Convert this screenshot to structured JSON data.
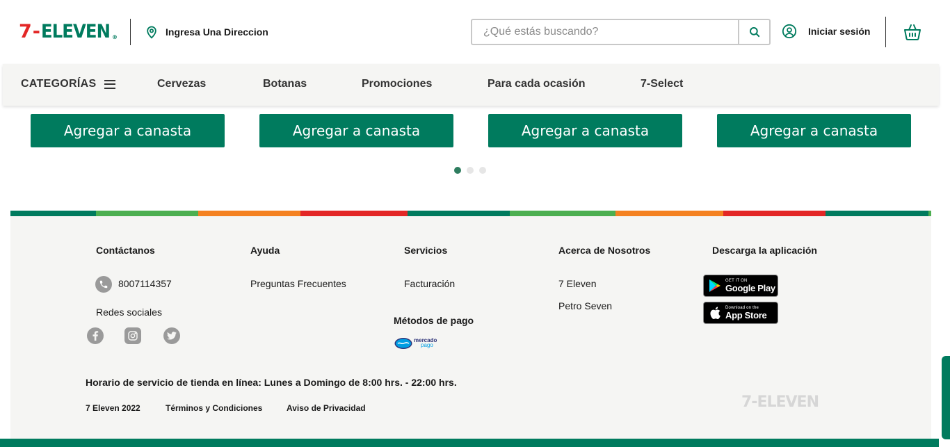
{
  "header": {
    "logo": {
      "seven": "7",
      "dash": "-",
      "eleven": "ELEVEN",
      "reg": "®"
    },
    "location_label": "Ingresa Una Direccion",
    "search_placeholder": "¿Qué estás buscando?",
    "search_value": "",
    "login_label": "Iniciar sesión",
    "icons": {
      "location": "map-pin-icon",
      "search": "search-icon",
      "user": "user-circle-icon",
      "cart": "basket-icon"
    }
  },
  "nav": {
    "categories_label": "CATEGORÍAS",
    "items": [
      "Cervezas",
      "Botanas",
      "Promociones",
      "Para cada ocasión",
      "7-Select"
    ]
  },
  "products": {
    "add_button_label": "Agregar a canasta",
    "carousel_pages": 3,
    "carousel_active": 1
  },
  "footer": {
    "contact": {
      "title": "Contáctanos",
      "phone": "8007114357",
      "social_title": "Redes sociales",
      "social_icons": [
        "facebook-icon",
        "instagram-icon",
        "twitter-icon"
      ]
    },
    "help": {
      "title": "Ayuda",
      "links": [
        "Preguntas Frecuentes"
      ]
    },
    "services": {
      "title": "Servicios",
      "links": [
        "Facturación"
      ],
      "payment_title": "Métodos de pago",
      "payment_logo": {
        "line1": "mercado",
        "line2": "pago"
      }
    },
    "about": {
      "title": "Acerca de Nosotros",
      "links": [
        "7 Eleven",
        "Petro Seven"
      ]
    },
    "app": {
      "title": "Descarga la aplicación",
      "google": {
        "small": "GET IT ON",
        "big": "Google Play"
      },
      "apple": {
        "small": "Download on the",
        "big": "App Store"
      }
    },
    "hours": "Horario de servicio de tienda en línea: Lunes a Domingo de 8:00 hrs. - 22:00 hrs.",
    "legal": [
      "7 Eleven 2022",
      "Términos y Condiciones",
      "Aviso de Privacidad"
    ],
    "logo_text": "7-ELEVEN"
  },
  "colors": {
    "brand_green": "#007b5e",
    "brand_red": "#e32726",
    "brand_orange": "#f48120",
    "light_green": "#4caf50",
    "footer_bg": "#f5f5f3"
  }
}
